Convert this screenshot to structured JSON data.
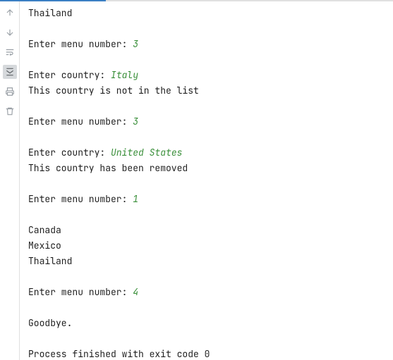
{
  "toolbar": {
    "icons": [
      {
        "name": "arrow-up-icon"
      },
      {
        "name": "arrow-down-icon"
      },
      {
        "name": "wrap-icon"
      },
      {
        "name": "scroll-to-end-icon"
      },
      {
        "name": "print-icon"
      },
      {
        "name": "trash-icon"
      }
    ]
  },
  "console": {
    "lines": [
      {
        "text": "Thailand"
      },
      {
        "text": ""
      },
      {
        "prompt": "Enter menu number: ",
        "input": "3"
      },
      {
        "text": ""
      },
      {
        "prompt": "Enter country: ",
        "input": "Italy"
      },
      {
        "text": "This country is not in the list"
      },
      {
        "text": ""
      },
      {
        "prompt": "Enter menu number: ",
        "input": "3"
      },
      {
        "text": ""
      },
      {
        "prompt": "Enter country: ",
        "input": "United States"
      },
      {
        "text": "This country has been removed"
      },
      {
        "text": ""
      },
      {
        "prompt": "Enter menu number: ",
        "input": "1"
      },
      {
        "text": ""
      },
      {
        "text": "Canada"
      },
      {
        "text": "Mexico"
      },
      {
        "text": "Thailand"
      },
      {
        "text": ""
      },
      {
        "prompt": "Enter menu number: ",
        "input": "4"
      },
      {
        "text": ""
      },
      {
        "text": "Goodbye."
      },
      {
        "text": ""
      },
      {
        "text": "Process finished with exit code 0",
        "exit": true
      }
    ]
  }
}
